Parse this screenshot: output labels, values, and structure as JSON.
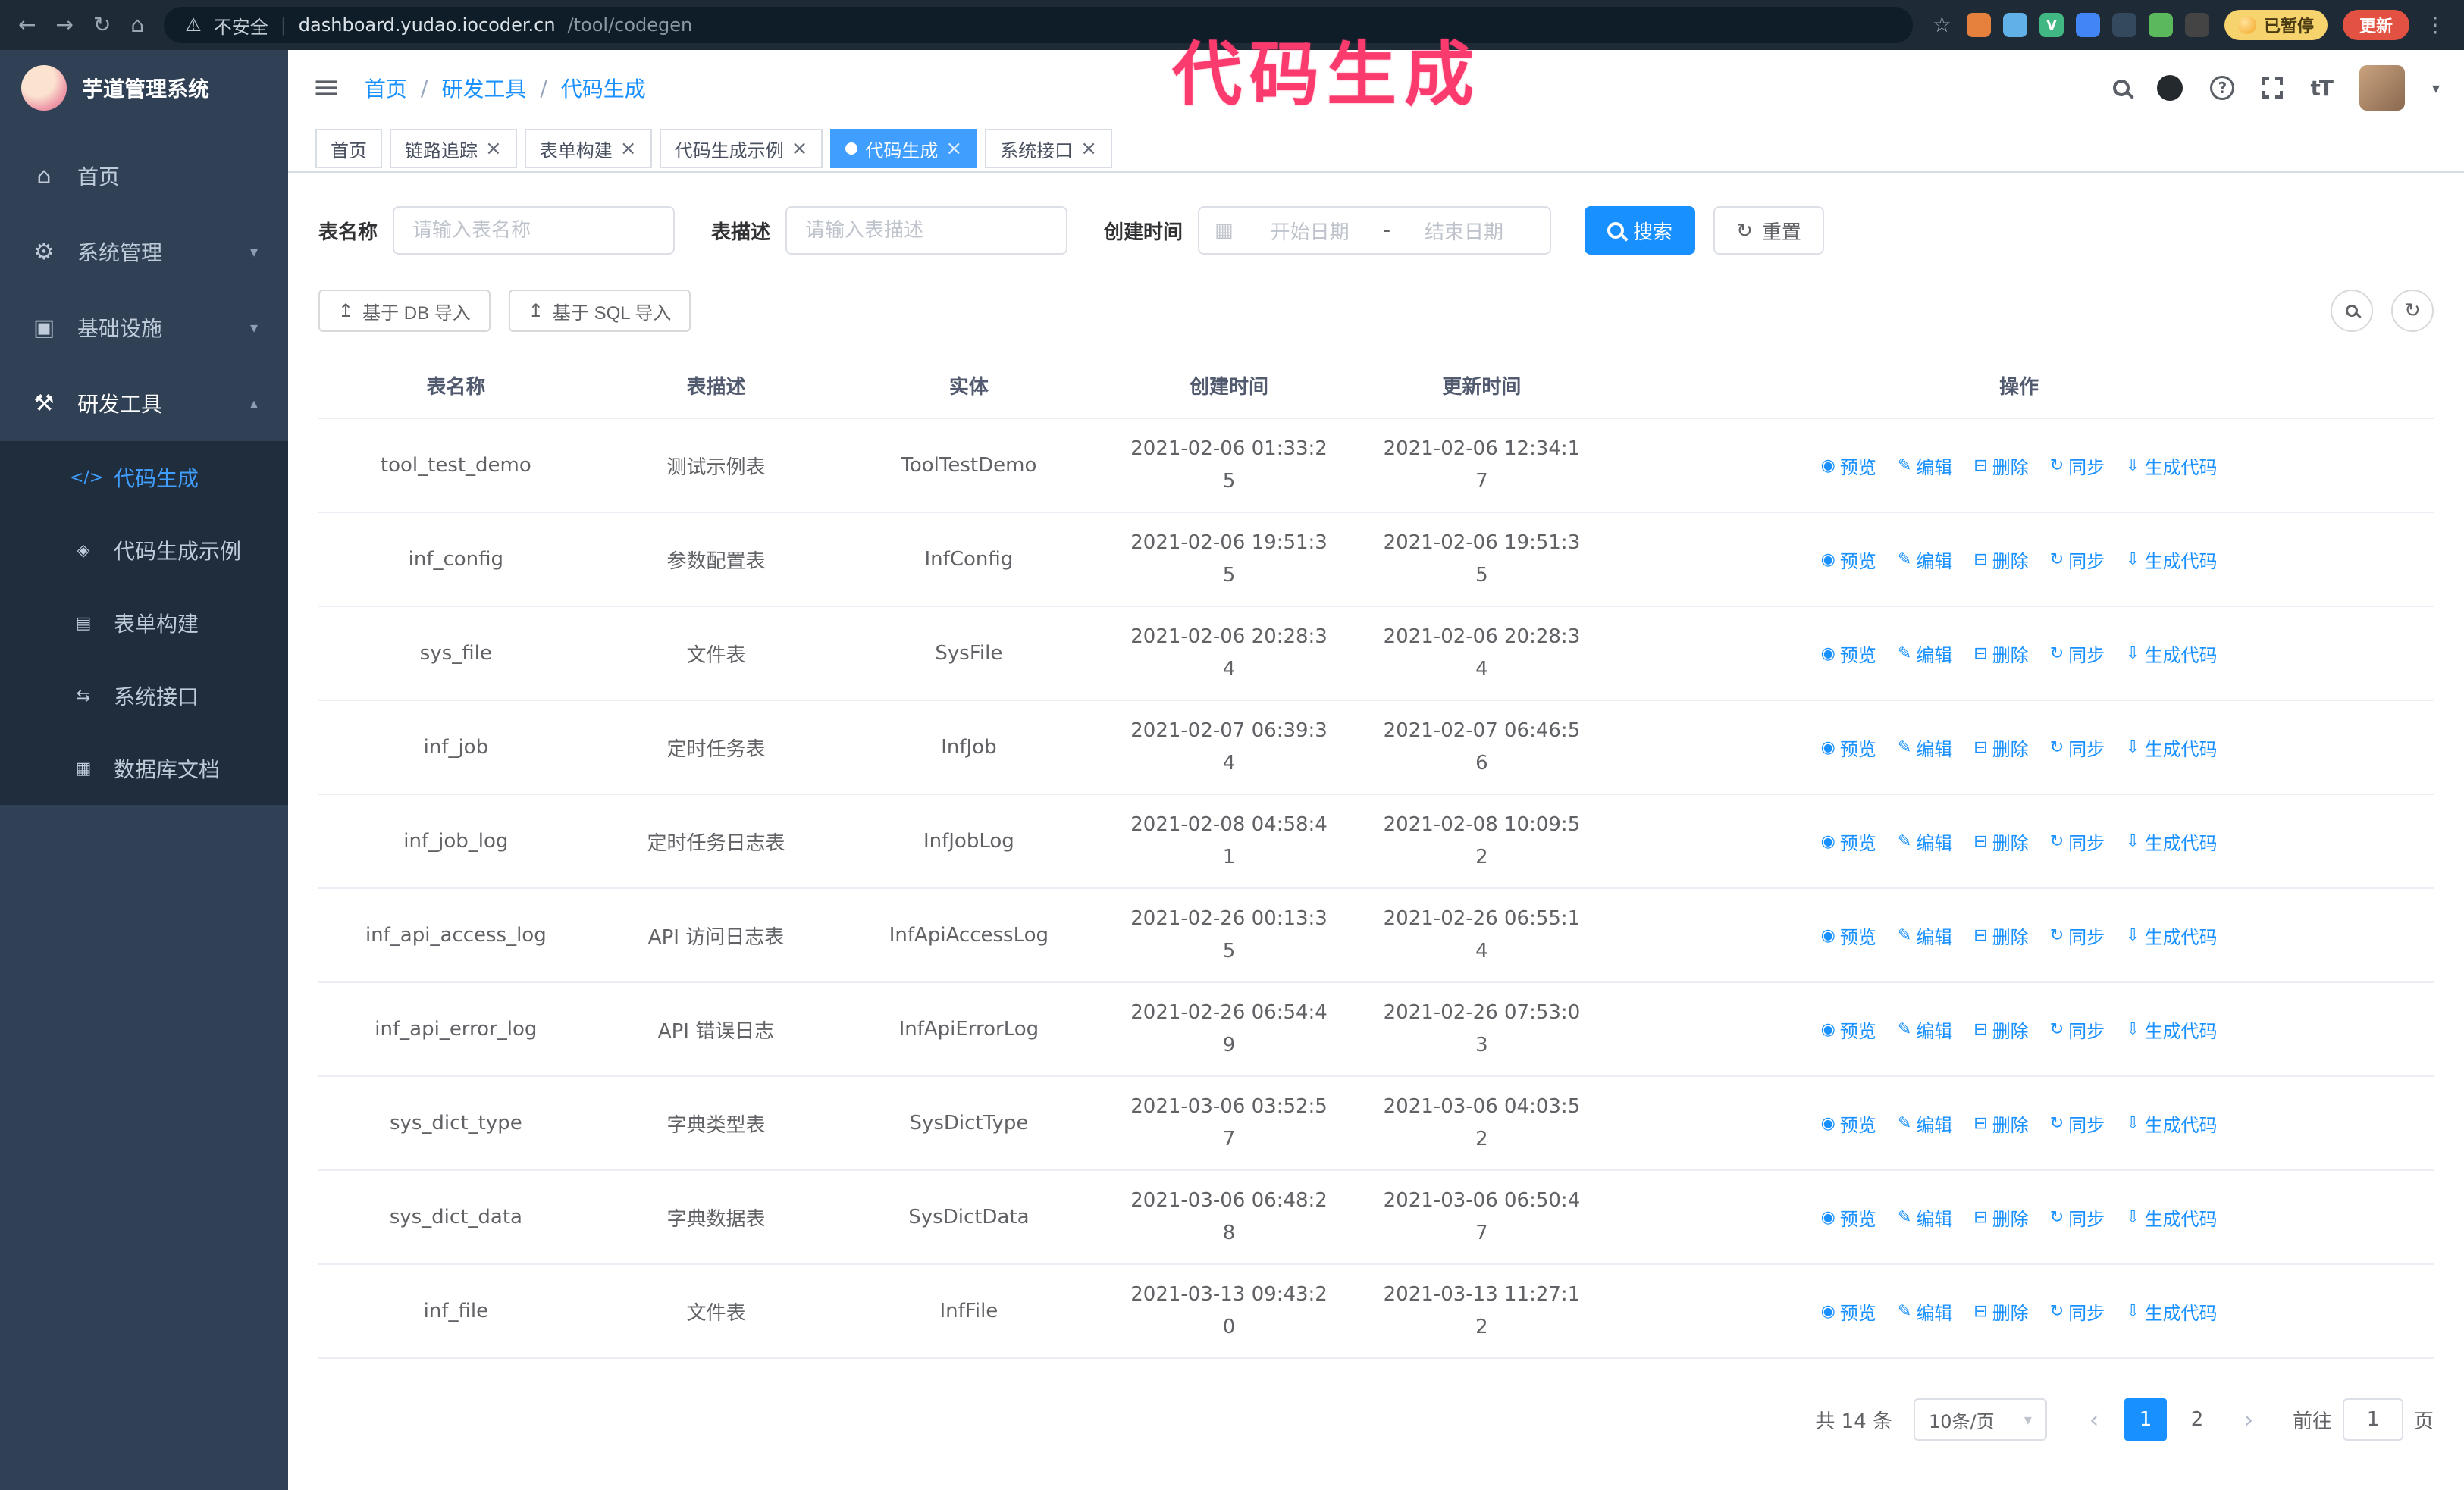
{
  "browser": {
    "security_warning": "不安全",
    "url_domain": "dashboard.yudao.iocoder.cn",
    "url_path": "/tool/codegen",
    "paused_label": "已暂停",
    "update_label": "更新",
    "extensions": [
      {
        "name": "lion-extension-icon",
        "color": "#e5813c",
        "glyph": ""
      },
      {
        "name": "drop-extension-icon",
        "color": "#62b0e8",
        "glyph": ""
      },
      {
        "name": "vue-devtools-icon",
        "color": "#41b883",
        "glyph": "V"
      },
      {
        "name": "people-extension-icon",
        "color": "#4285f4",
        "glyph": ""
      },
      {
        "name": "screen-extension-icon",
        "color": "#35495e",
        "glyph": ""
      },
      {
        "name": "leaf-extension-icon",
        "color": "#5cb85c",
        "glyph": ""
      },
      {
        "name": "puzzle-extension-icon",
        "color": "#444444",
        "glyph": ""
      }
    ]
  },
  "annotation": {
    "text": "代码生成"
  },
  "sidebar": {
    "logo_title": "芋道管理系统",
    "menu": [
      {
        "label": "首页"
      },
      {
        "label": "系统管理"
      },
      {
        "label": "基础设施"
      },
      {
        "label": "研发工具"
      }
    ],
    "submenu": [
      {
        "label": "代码生成",
        "active": true
      },
      {
        "label": "代码生成示例"
      },
      {
        "label": "表单构建"
      },
      {
        "label": "系统接口"
      },
      {
        "label": "数据库文档"
      }
    ]
  },
  "header": {
    "breadcrumb": [
      "首页",
      "研发工具",
      "代码生成"
    ]
  },
  "tabs": [
    {
      "label": "首页",
      "closable": false,
      "active": false
    },
    {
      "label": "链路追踪",
      "closable": true,
      "active": false
    },
    {
      "label": "表单构建",
      "closable": true,
      "active": false
    },
    {
      "label": "代码生成示例",
      "closable": true,
      "active": false
    },
    {
      "label": "代码生成",
      "closable": true,
      "active": true
    },
    {
      "label": "系统接口",
      "closable": true,
      "active": false
    }
  ],
  "filters": {
    "table_name_label": "表名称",
    "table_name_placeholder": "请输入表名称",
    "table_desc_label": "表描述",
    "table_desc_placeholder": "请输入表描述",
    "create_time_label": "创建时间",
    "start_date_placeholder": "开始日期",
    "range_separator": "-",
    "end_date_placeholder": "结束日期",
    "search_label": "搜索",
    "reset_label": "重置"
  },
  "toolbar": {
    "import_db_label": "基于 DB 导入",
    "import_sql_label": "基于 SQL 导入"
  },
  "table": {
    "columns": [
      "表名称",
      "表描述",
      "实体",
      "创建时间",
      "更新时间",
      "操作"
    ],
    "actions": [
      "预览",
      "编辑",
      "删除",
      "同步",
      "生成代码"
    ],
    "action_keys": [
      "preview",
      "edit",
      "delete",
      "sync",
      "generate-code"
    ],
    "rows": [
      {
        "name": "tool_test_demo",
        "desc": "测试示例表",
        "entity": "ToolTestDemo",
        "created": "2021-02-06 01:33:25",
        "updated": "2021-02-06 12:34:17"
      },
      {
        "name": "inf_config",
        "desc": "参数配置表",
        "entity": "InfConfig",
        "created": "2021-02-06 19:51:35",
        "updated": "2021-02-06 19:51:35"
      },
      {
        "name": "sys_file",
        "desc": "文件表",
        "entity": "SysFile",
        "created": "2021-02-06 20:28:34",
        "updated": "2021-02-06 20:28:34"
      },
      {
        "name": "inf_job",
        "desc": "定时任务表",
        "entity": "InfJob",
        "created": "2021-02-07 06:39:34",
        "updated": "2021-02-07 06:46:56"
      },
      {
        "name": "inf_job_log",
        "desc": "定时任务日志表",
        "entity": "InfJobLog",
        "created": "2021-02-08 04:58:41",
        "updated": "2021-02-08 10:09:52"
      },
      {
        "name": "inf_api_access_log",
        "desc": "API 访问日志表",
        "entity": "InfApiAccessLog",
        "created": "2021-02-26 00:13:35",
        "updated": "2021-02-26 06:55:14"
      },
      {
        "name": "inf_api_error_log",
        "desc": "API 错误日志",
        "entity": "InfApiErrorLog",
        "created": "2021-02-26 06:54:49",
        "updated": "2021-02-26 07:53:03"
      },
      {
        "name": "sys_dict_type",
        "desc": "字典类型表",
        "entity": "SysDictType",
        "created": "2021-03-06 03:52:57",
        "updated": "2021-03-06 04:03:52"
      },
      {
        "name": "sys_dict_data",
        "desc": "字典数据表",
        "entity": "SysDictData",
        "created": "2021-03-06 06:48:28",
        "updated": "2021-03-06 06:50:47"
      },
      {
        "name": "inf_file",
        "desc": "文件表",
        "entity": "InfFile",
        "created": "2021-03-13 09:43:20",
        "updated": "2021-03-13 11:27:12"
      }
    ]
  },
  "pagination": {
    "total_label": "共 14 条",
    "page_size_label": "10条/页",
    "pages": [
      "1",
      "2"
    ],
    "current_page": "1",
    "goto_prefix": "前往",
    "goto_value": "1",
    "goto_suffix": "页"
  },
  "icons": {
    "back": "←",
    "forward": "→",
    "reload": "↻",
    "browser_home": "⌂",
    "warning": "⚠",
    "divider": "|",
    "star": "☆",
    "kebab": "⋮",
    "hamburger": "≡",
    "home": "⌂",
    "system": "⚙",
    "infra": "▣",
    "tools": "⚒",
    "chevron_down": "▾",
    "chevron_up": "▴",
    "sub_codegen": "</>",
    "sub_demo": "◈",
    "sub_form": "▤",
    "sub_api": "⇆",
    "sub_db": "▦",
    "question": "?",
    "fontsize": "tT",
    "avatar_caret": "▾",
    "calendar": "▦",
    "reset": "↻",
    "upload": "↥",
    "refresh": "↻",
    "action_glyphs": [
      "◉",
      "✎",
      "⊟",
      "↻",
      "⇩"
    ],
    "close": "×",
    "select_caret": "▾",
    "prev": "‹",
    "next": "›"
  },
  "colors": {
    "accent": "#1890ff",
    "tab_active": "#409eff",
    "annotation": "#fb3b6e",
    "sidebar_bg": "#304156",
    "submenu_bg": "#1f2d3d",
    "browser_bar_bg": "#1e2b36"
  }
}
